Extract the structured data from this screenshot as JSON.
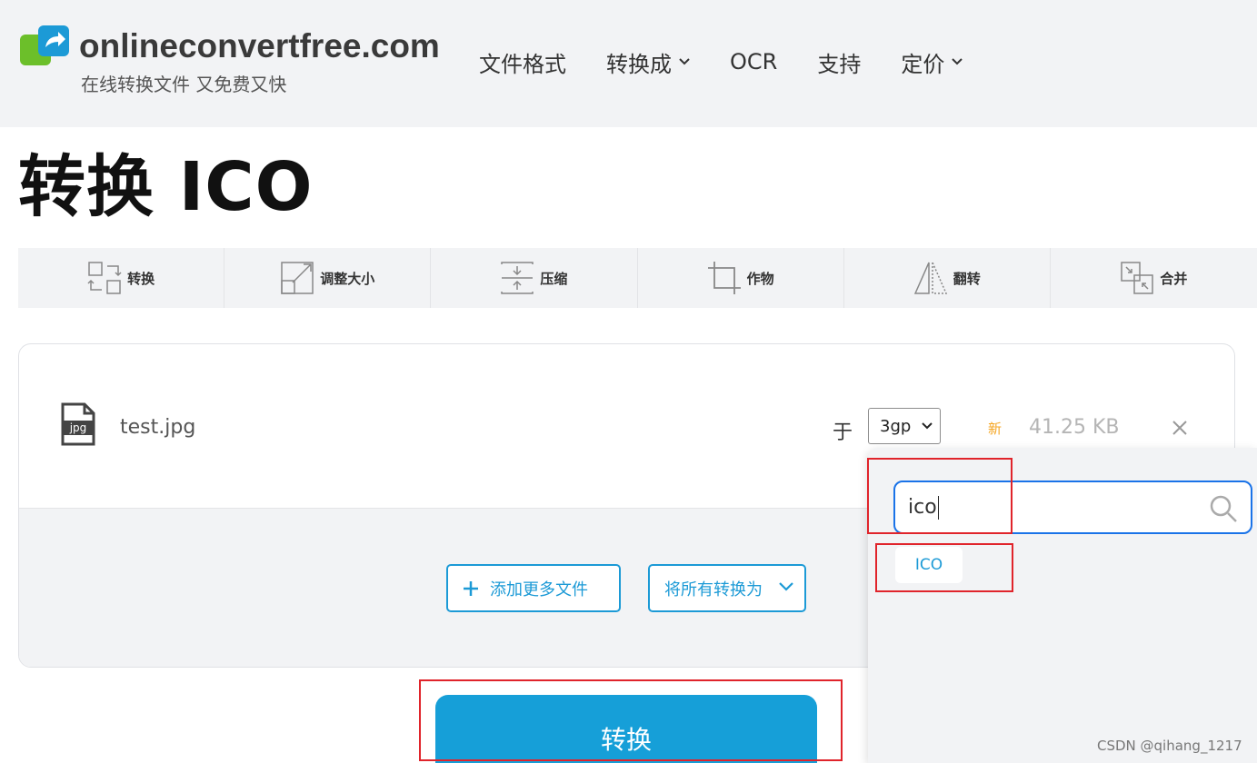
{
  "header": {
    "site_name": "onlineconvertfree.com",
    "tagline": "在线转换文件 又免费又快",
    "nav": [
      {
        "label": "文件格式",
        "has_dropdown": false
      },
      {
        "label": "转换成",
        "has_dropdown": true
      },
      {
        "label": "OCR",
        "has_dropdown": false
      },
      {
        "label": "支持",
        "has_dropdown": false
      },
      {
        "label": "定价",
        "has_dropdown": true
      }
    ]
  },
  "page_title": "转换 ICO",
  "tools": [
    {
      "label": "转换",
      "icon": "convert-icon"
    },
    {
      "label": "调整大小",
      "icon": "resize-icon"
    },
    {
      "label": "压缩",
      "icon": "compress-icon"
    },
    {
      "label": "作物",
      "icon": "crop-icon"
    },
    {
      "label": "翻转",
      "icon": "flip-icon"
    },
    {
      "label": "合并",
      "icon": "merge-icon"
    }
  ],
  "file": {
    "icon_label": "jpg",
    "name": "test.jpg",
    "to_label": "于",
    "format_selected": "3gp",
    "new_badge": "新",
    "size": "41.25 KB"
  },
  "actions": {
    "add_more": "添加更多文件",
    "convert_all": "将所有转换为",
    "convert": "转换"
  },
  "dropdown": {
    "search_value": "ico",
    "options": [
      "ICO"
    ]
  },
  "colors": {
    "accent": "#169fd8",
    "header_bg": "#f2f3f5",
    "annotation": "#e0242b",
    "new_badge": "#f5a623"
  },
  "watermark": "CSDN @qihang_1217"
}
